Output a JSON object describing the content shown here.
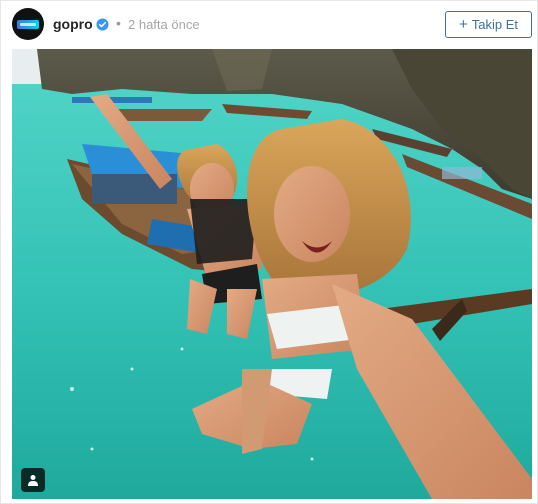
{
  "post": {
    "username": "gopro",
    "separator": "•",
    "time_ago": "2 hafta önce",
    "verified": true,
    "follow_label": "Takip Et",
    "follow_icon": "+",
    "tag_icon": "person-tag-icon"
  },
  "colors": {
    "accent": "#3f729b",
    "verified": "#3897f0",
    "muted": "#a5a7aa",
    "water": "#37c4b8"
  }
}
